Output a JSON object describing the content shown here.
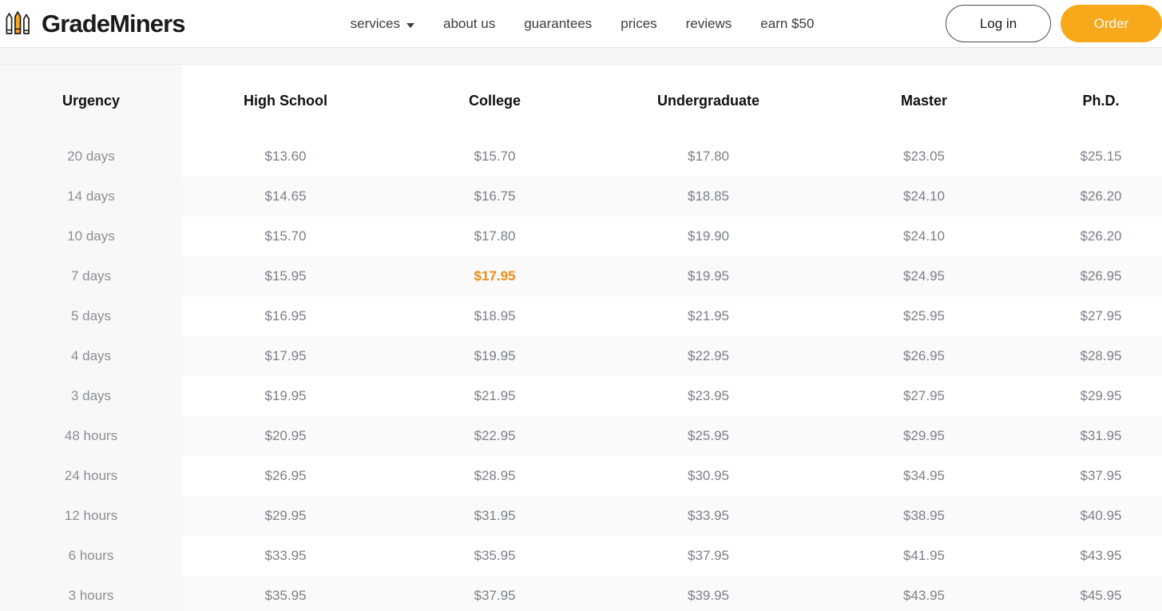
{
  "header": {
    "brand_name": "GradeMiners",
    "brand_icon": "three-pencils-icon",
    "nav": [
      {
        "label": "services",
        "has_dropdown": true,
        "caret_icon": "chevron-down-icon"
      },
      {
        "label": "about us",
        "has_dropdown": false
      },
      {
        "label": "guarantees",
        "has_dropdown": false
      },
      {
        "label": "prices",
        "has_dropdown": false
      },
      {
        "label": "reviews",
        "has_dropdown": false
      },
      {
        "label": "earn $50",
        "has_dropdown": false
      }
    ],
    "login_label": "Log in",
    "order_label": "Order"
  },
  "colors": {
    "accent": "#f7a81b",
    "featured_price": "#ef8b17",
    "text_dark": "#1b1b1b",
    "text_muted": "#7b8189",
    "row_alt": "#fafafa",
    "urgency_column": "#f8f8f8"
  },
  "price_table": {
    "columns": [
      "Urgency",
      "High School",
      "College",
      "Undergraduate",
      "Master",
      "Ph.D."
    ],
    "featured_cell": {
      "row": "7 days",
      "column": "College",
      "value": "$17.95"
    },
    "rows": [
      {
        "urgency": "20 days",
        "high_school": "$13.60",
        "college": "$15.70",
        "undergraduate": "$17.80",
        "master": "$23.05",
        "phd": "$25.15"
      },
      {
        "urgency": "14 days",
        "high_school": "$14.65",
        "college": "$16.75",
        "undergraduate": "$18.85",
        "master": "$24.10",
        "phd": "$26.20"
      },
      {
        "urgency": "10 days",
        "high_school": "$15.70",
        "college": "$17.80",
        "undergraduate": "$19.90",
        "master": "$24.10",
        "phd": "$26.20"
      },
      {
        "urgency": "7 days",
        "high_school": "$15.95",
        "college": "$17.95",
        "undergraduate": "$19.95",
        "master": "$24.95",
        "phd": "$26.95"
      },
      {
        "urgency": "5 days",
        "high_school": "$16.95",
        "college": "$18.95",
        "undergraduate": "$21.95",
        "master": "$25.95",
        "phd": "$27.95"
      },
      {
        "urgency": "4 days",
        "high_school": "$17.95",
        "college": "$19.95",
        "undergraduate": "$22.95",
        "master": "$26.95",
        "phd": "$28.95"
      },
      {
        "urgency": "3 days",
        "high_school": "$19.95",
        "college": "$21.95",
        "undergraduate": "$23.95",
        "master": "$27.95",
        "phd": "$29.95"
      },
      {
        "urgency": "48 hours",
        "high_school": "$20.95",
        "college": "$22.95",
        "undergraduate": "$25.95",
        "master": "$29.95",
        "phd": "$31.95"
      },
      {
        "urgency": "24 hours",
        "high_school": "$26.95",
        "college": "$28.95",
        "undergraduate": "$30.95",
        "master": "$34.95",
        "phd": "$37.95"
      },
      {
        "urgency": "12 hours",
        "high_school": "$29.95",
        "college": "$31.95",
        "undergraduate": "$33.95",
        "master": "$38.95",
        "phd": "$40.95"
      },
      {
        "urgency": "6 hours",
        "high_school": "$33.95",
        "college": "$35.95",
        "undergraduate": "$37.95",
        "master": "$41.95",
        "phd": "$43.95"
      },
      {
        "urgency": "3 hours",
        "high_school": "$35.95",
        "college": "$37.95",
        "undergraduate": "$39.95",
        "master": "$43.95",
        "phd": "$45.95"
      }
    ]
  }
}
